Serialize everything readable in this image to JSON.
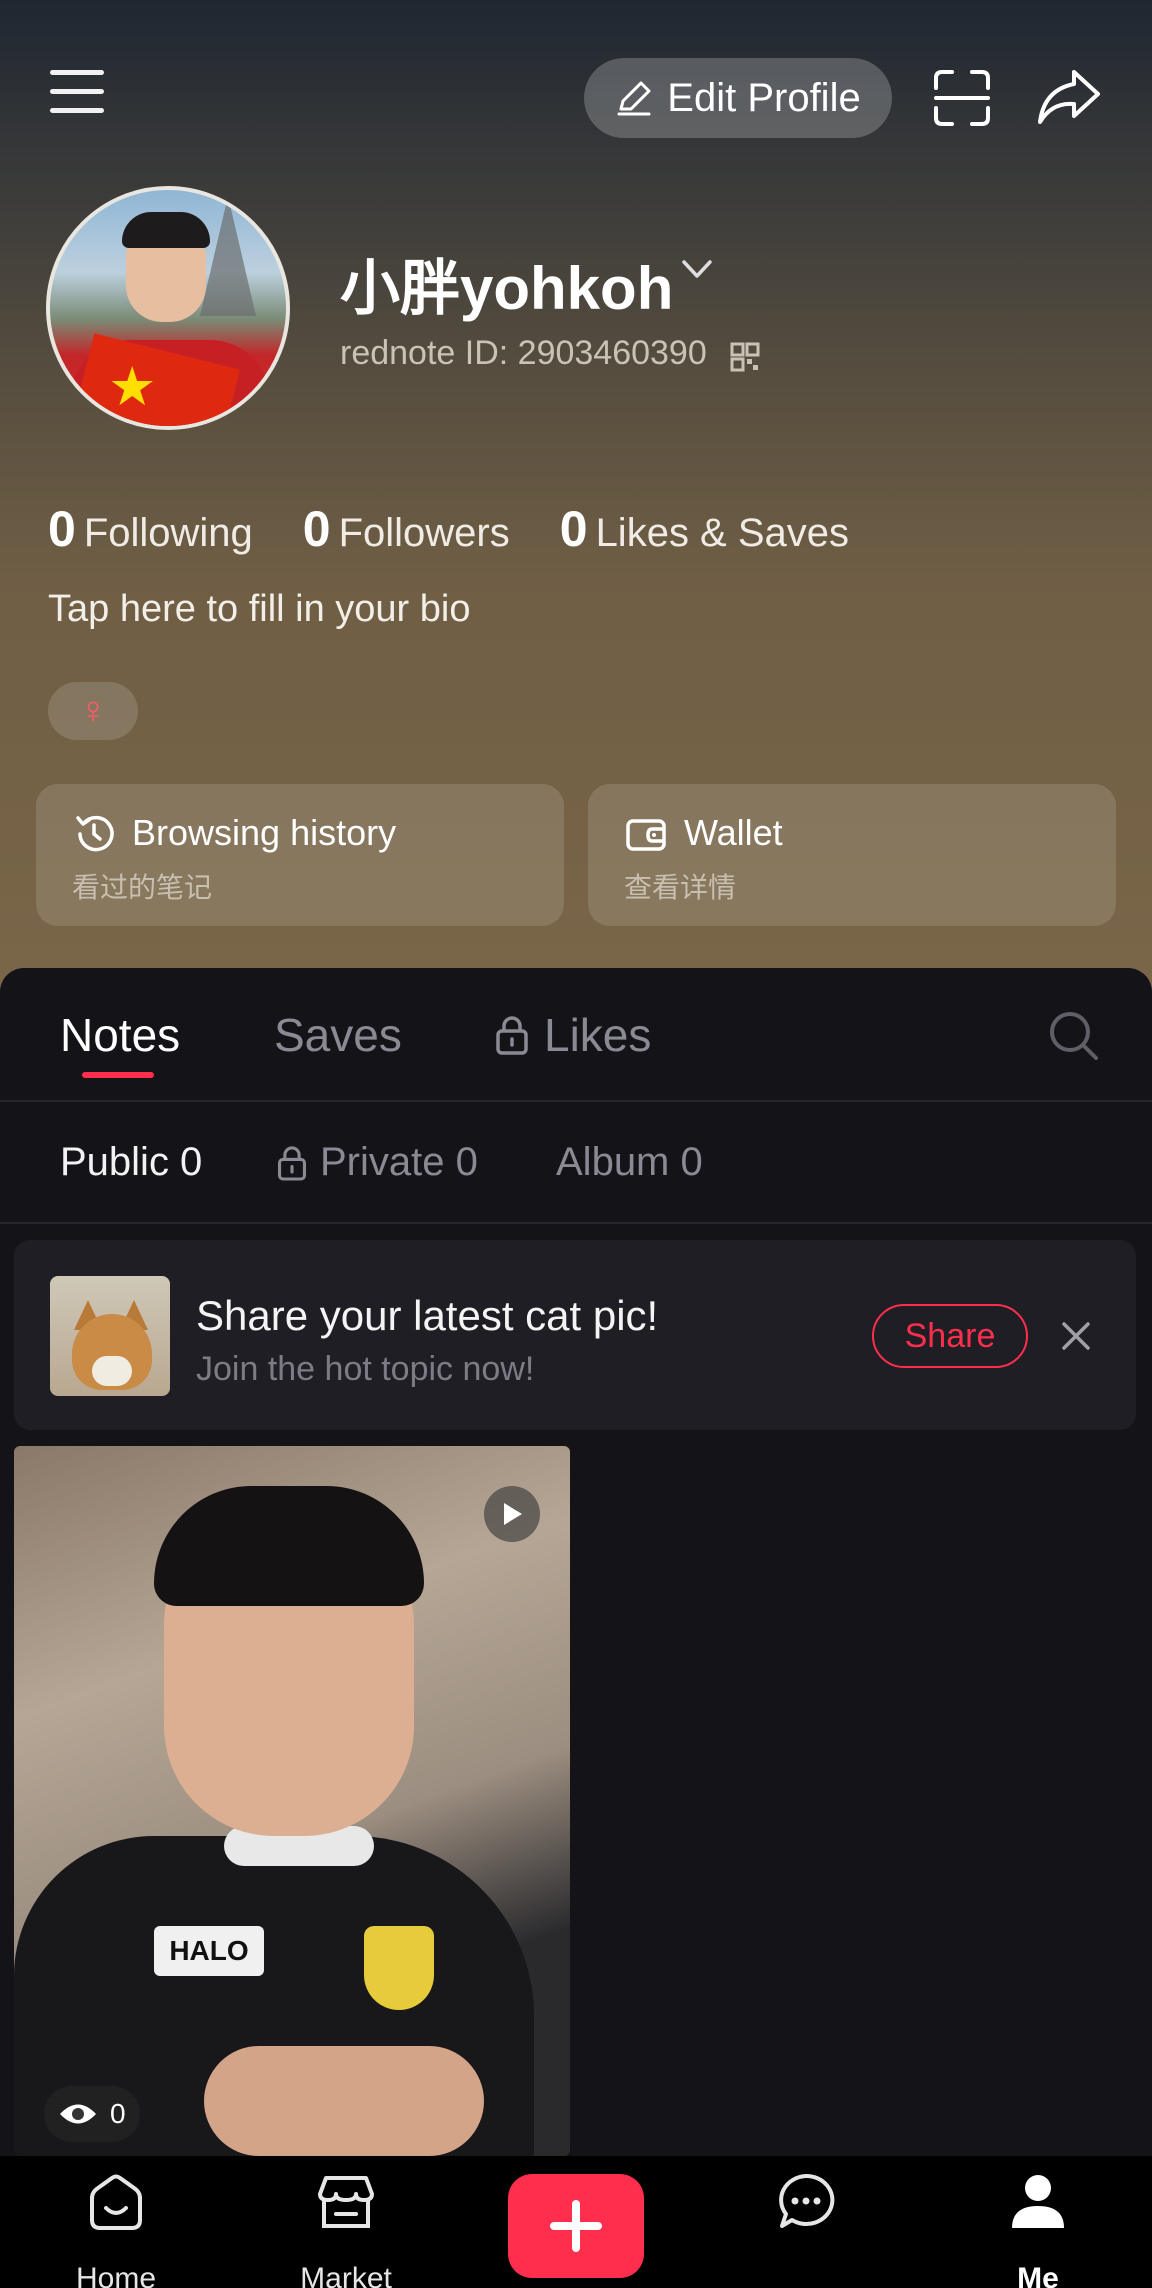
{
  "header": {
    "edit_profile_label": "Edit Profile"
  },
  "profile": {
    "username": "小胖yohkoh",
    "rednote_id": "rednote ID: 2903460390",
    "stats": [
      {
        "count": "0",
        "label": "Following"
      },
      {
        "count": "0",
        "label": "Followers"
      },
      {
        "count": "0",
        "label": "Likes & Saves"
      }
    ],
    "bio_placeholder": "Tap here to fill in your bio",
    "gender_symbol": "♀"
  },
  "quick_cards": {
    "history": {
      "title": "Browsing history",
      "subtitle": "看过的笔记"
    },
    "wallet": {
      "title": "Wallet",
      "subtitle": "查看详情"
    }
  },
  "tabs": {
    "notes": "Notes",
    "saves": "Saves",
    "likes": "Likes",
    "active": "Notes"
  },
  "subtabs": {
    "public": "Public 0",
    "private": "Private 0",
    "album": "Album 0",
    "active": "Public 0"
  },
  "promo": {
    "title": "Share your latest cat pic!",
    "subtitle": "Join the hot topic now!",
    "share_label": "Share"
  },
  "note_card": {
    "views": "0",
    "shirt_logo_text": "HALO"
  },
  "bottom_nav": {
    "home": "Home",
    "market": "Market",
    "me": "Me",
    "active": "Me"
  },
  "colors": {
    "accent": "#ff2e4d",
    "panel_bg": "#131318"
  }
}
